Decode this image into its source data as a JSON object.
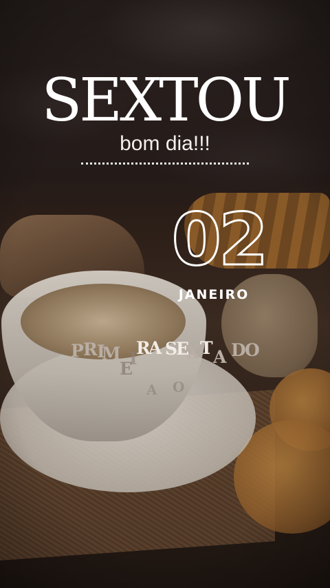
{
  "post": {
    "title": "SEXTOU",
    "greeting": "bom dia!!!",
    "day": "02",
    "month": "JANEIRO"
  },
  "animated_caption": {
    "letters": [
      "P",
      "R",
      "I",
      "M",
      "E",
      "I",
      "R",
      "A",
      "S",
      "E",
      "X",
      "T",
      "A",
      "D",
      "O",
      "A",
      "O"
    ]
  },
  "colors": {
    "text": "#ffffff",
    "letter_bright": "#f2ece6",
    "letter_faded": "#b9aea4"
  }
}
